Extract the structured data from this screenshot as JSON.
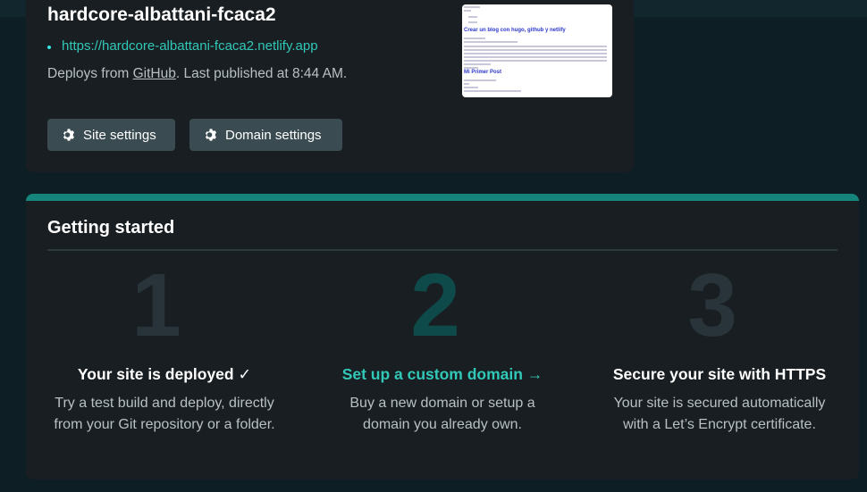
{
  "site": {
    "name": "hardcore-albattani-fcaca2",
    "url": "https://hardcore-albattani-fcaca2.netlify.app",
    "deploy_prefix": "Deploys from ",
    "deploy_source": "GitHub",
    "deploy_suffix": ". Last published at 8:44 AM.",
    "site_settings_label": "Site settings",
    "domain_settings_label": "Domain settings",
    "preview": {
      "post1_title": "Crear un blog con hugo, github y netlify",
      "post2_title": "Mi Primer Post"
    }
  },
  "getting_started": {
    "title": "Getting started",
    "steps": [
      {
        "number": "1",
        "title": "Your site is deployed ✓",
        "desc_line1": "Try a test build and deploy, directly",
        "desc_line2": "from your Git repository or a folder."
      },
      {
        "number": "2",
        "title": "Set up a custom domain →",
        "desc_line1": "Buy a new domain or setup a",
        "desc_line2": "domain you already own."
      },
      {
        "number": "3",
        "title": "Secure your site with HTTPS",
        "desc_line1": "Your site is secured automatically",
        "desc_line2": "with a Let’s Encrypt certificate."
      }
    ]
  },
  "colors": {
    "accent": "#32c8b8",
    "topbar": "#15847b",
    "card": "#181e21",
    "background": "#0e1e25"
  },
  "icons": [
    "gear-icon",
    "gear-icon"
  ]
}
